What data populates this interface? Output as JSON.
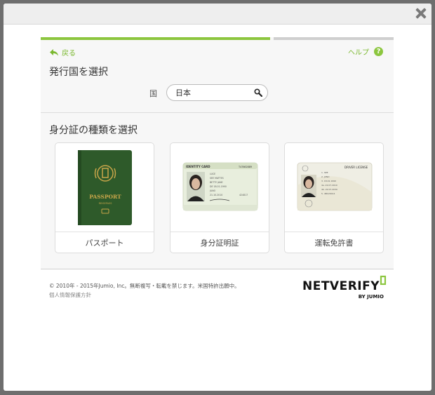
{
  "modal": {
    "close_icon": "close-icon"
  },
  "progress": {
    "percent": 65
  },
  "nav": {
    "back_label": "戻る",
    "help_label": "ヘルプ",
    "help_symbol": "?"
  },
  "country_section": {
    "title": "発行国を選択",
    "label": "国",
    "value": "日本",
    "search_icon": "search-icon"
  },
  "document_section": {
    "title": "身分証の種類を選択",
    "cards": [
      {
        "label": "パスポート",
        "image": "passport-image"
      },
      {
        "label": "身分証明証",
        "image": "identity-card-image"
      },
      {
        "label": "運転免許書",
        "image": "driver-license-image"
      }
    ]
  },
  "footer": {
    "copyright": "© 2010年 - 2015年Jumio, Inc。無断複写・転載を禁じます。米国特許出願中。",
    "privacy": "個人情報保護方針",
    "logo_main": "NETVERIFY",
    "logo_sub": "BY JUMIO"
  },
  "colors": {
    "accent": "#8cc63f",
    "link": "#7ab82e",
    "passport": "#2e5a2a"
  }
}
